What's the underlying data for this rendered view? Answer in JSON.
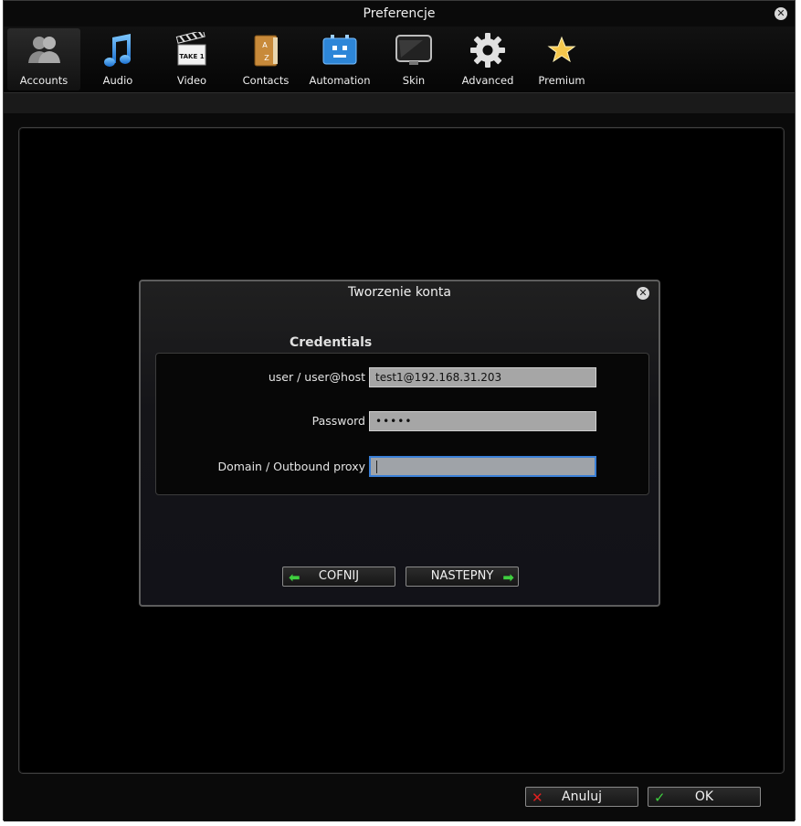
{
  "window": {
    "title": "Preferencje",
    "close_glyph": "✕"
  },
  "toolbar": {
    "items": [
      {
        "label": "Accounts",
        "icon": "accounts-icon"
      },
      {
        "label": "Audio",
        "icon": "music-note-icon"
      },
      {
        "label": "Video",
        "icon": "clapperboard-icon"
      },
      {
        "label": "Contacts",
        "icon": "address-book-icon"
      },
      {
        "label": "Automation",
        "icon": "robot-icon"
      },
      {
        "label": "Skin",
        "icon": "monitor-icon"
      },
      {
        "label": "Advanced",
        "icon": "gear-icon"
      },
      {
        "label": "Premium",
        "icon": "star-icon"
      }
    ],
    "clapper_text": "TAKE 1",
    "contacts_letters": [
      "A",
      "Z"
    ]
  },
  "dialog": {
    "title": "Tworzenie konta",
    "close_glyph": "✕",
    "section_title": "Credentials",
    "fields": [
      {
        "label": "user / user@host",
        "value": "test1@192.168.31.203"
      },
      {
        "label": "Password",
        "value": "•••••"
      },
      {
        "label": "Domain / Outbound proxy",
        "value": ""
      }
    ],
    "back_label": "COFNIJ",
    "next_label": "NASTEPNY"
  },
  "footer": {
    "cancel_label": "Anuluj",
    "ok_label": "OK"
  },
  "colors": {
    "accent_green": "#3fcf3f",
    "cancel_red": "#e02020",
    "focus_blue": "#3a7fd6"
  }
}
